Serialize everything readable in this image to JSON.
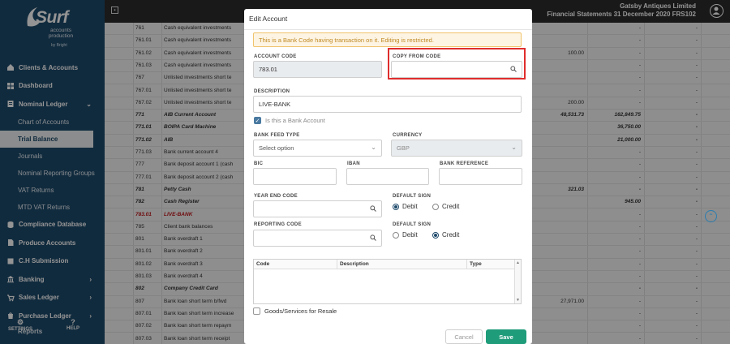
{
  "app": {
    "logo_text": "Surf",
    "logo_sub": "accounts production",
    "logo_by": "by Bright"
  },
  "sidebar": {
    "items": [
      {
        "label": "Clients & Accounts",
        "icon": "home-icon"
      },
      {
        "label": "Dashboard",
        "icon": "dashboard-icon"
      },
      {
        "label": "Nominal Ledger",
        "icon": "ledger-icon",
        "chevron": "⌄"
      }
    ],
    "sub_items": [
      {
        "label": "Chart of Accounts"
      },
      {
        "label": "Trial Balance",
        "active": true
      },
      {
        "label": "Journals"
      },
      {
        "label": "Nominal Reporting Groups"
      },
      {
        "label": "VAT Returns"
      },
      {
        "label": "MTD VAT Returns"
      }
    ],
    "items2": [
      {
        "label": "Compliance Database",
        "icon": "database-icon"
      },
      {
        "label": "Produce Accounts",
        "icon": "document-icon"
      },
      {
        "label": "C.H Submission",
        "icon": "upload-icon"
      },
      {
        "label": "Banking",
        "icon": "bank-icon",
        "chevron": "›"
      },
      {
        "label": "Sales Ledger",
        "icon": "sales-icon",
        "chevron": "›"
      },
      {
        "label": "Purchase Ledger",
        "icon": "purchase-icon",
        "chevron": "›"
      }
    ],
    "settings_label": "SETTINGS",
    "help_label": "HELP",
    "reports_label": "Reports"
  },
  "topbar": {
    "company": "Gatsby Antiques Limited",
    "statement": "Financial Statements 31 December 2020 FRS102"
  },
  "grid_rows": [
    {
      "code": "761",
      "name": "Cash equivalent investments",
      "v1": "",
      "v2": "-",
      "v3": "-"
    },
    {
      "code": "761.01",
      "name": "Cash equivalent investments",
      "v1": "",
      "v2": "-",
      "v3": "-"
    },
    {
      "code": "761.02",
      "name": "Cash equivalent investments",
      "v1": "100.00",
      "v2": "-",
      "v3": "-"
    },
    {
      "code": "761.03",
      "name": "Cash equivalent investments",
      "v1": "",
      "v2": "-",
      "v3": "-"
    },
    {
      "code": "767",
      "name": "Unlisted investments short te",
      "v1": "",
      "v2": "-",
      "v3": "-"
    },
    {
      "code": "767.01",
      "name": "Unlisted investments short te",
      "v1": "",
      "v2": "-",
      "v3": "-"
    },
    {
      "code": "767.02",
      "name": "Unlisted investments short te",
      "v1": "200.00",
      "v2": "-",
      "v3": "-"
    },
    {
      "code": "771",
      "name": "AIB Current Account",
      "v1": "48,531.73",
      "v2": "162,849.75",
      "v3": "-",
      "bold": true
    },
    {
      "code": "771.01",
      "name": "BOIPA Card Machine",
      "v1": "",
      "v2": "36,750.00",
      "v3": "-",
      "bold": true
    },
    {
      "code": "771.02",
      "name": "AIB",
      "v1": "",
      "v2": "21,000.00",
      "v3": "-",
      "bold": true
    },
    {
      "code": "771.03",
      "name": "Bank current account 4",
      "v1": "",
      "v2": "-",
      "v3": "-"
    },
    {
      "code": "777",
      "name": "Bank deposit account 1 (cash",
      "v1": "",
      "v2": "-",
      "v3": "-"
    },
    {
      "code": "777.01",
      "name": "Bank deposit account 2 (cash",
      "v1": "",
      "v2": "-",
      "v3": "-"
    },
    {
      "code": "781",
      "name": "Petty Cash",
      "v1": "321.03",
      "v2": "-",
      "v3": "-",
      "bold": true
    },
    {
      "code": "782",
      "name": "Cash Register",
      "v1": "",
      "v2": "945.00",
      "v3": "-",
      "bold": true
    },
    {
      "code": "783.01",
      "name": "LIVE-BANK",
      "v1": "",
      "v2": "-",
      "v3": "-",
      "red": true
    },
    {
      "code": "785",
      "name": "Client bank balances",
      "v1": "",
      "v2": "-",
      "v3": "-"
    },
    {
      "code": "801",
      "name": "Bank overdraft 1",
      "v1": "",
      "v2": "-",
      "v3": "-"
    },
    {
      "code": "801.01",
      "name": "Bank overdraft 2",
      "v1": "",
      "v2": "-",
      "v3": "-"
    },
    {
      "code": "801.02",
      "name": "Bank overdraft 3",
      "v1": "",
      "v2": "-",
      "v3": "-"
    },
    {
      "code": "801.03",
      "name": "Bank overdraft 4",
      "v1": "",
      "v2": "-",
      "v3": "-"
    },
    {
      "code": "802",
      "name": "Company Credit Card",
      "v1": "",
      "v2": "-",
      "v3": "-",
      "bold": true
    },
    {
      "code": "807",
      "name": "Bank loan short term b/fwd",
      "v1": "27,971.00",
      "v2": "-",
      "v3": "-"
    },
    {
      "code": "807.01",
      "name": "Bank loan short term increase",
      "v1": "",
      "v2": "-",
      "v3": "-"
    },
    {
      "code": "807.02",
      "name": "Bank loan short term repaym",
      "v1": "",
      "v2": "-",
      "v3": "-"
    },
    {
      "code": "807.03",
      "name": "Bank loan short term receipt",
      "v1": "",
      "v2": "-",
      "v3": "-"
    }
  ],
  "modal": {
    "title": "Edit Account",
    "warning": "This is a Bank Code having transaction on it. Editing is restricted.",
    "account_code_label": "ACCOUNT CODE",
    "account_code_value": "783.01",
    "copy_from_label": "COPY FROM CODE",
    "copy_from_value": "",
    "description_label": "DESCRIPTION",
    "description_value": "LIVE-BANK",
    "is_bank_label": "Is this a Bank Account",
    "is_bank_checked": true,
    "bank_feed_label": "BANK FEED TYPE",
    "bank_feed_value": "Select option",
    "currency_label": "CURRENCY",
    "currency_value": "GBP",
    "bic_label": "BIC",
    "iban_label": "IBAN",
    "bank_ref_label": "BANK REFERENCE",
    "year_end_label": "YEAR END CODE",
    "default_sign_label": "DEFAULT SIGN",
    "default_sign_1": {
      "debit": "Debit",
      "credit": "Credit",
      "selected": "Debit"
    },
    "reporting_code_label": "REPORTING CODE",
    "default_sign_2_label": "DEFAULT SIGN",
    "default_sign_2": {
      "debit": "Debit",
      "credit": "Credit",
      "selected": "Credit"
    },
    "table_headers": [
      "Code",
      "Description",
      "Type"
    ],
    "goods_label": "Goods/Services for Resale",
    "cancel_label": "Cancel",
    "save_label": "Save"
  },
  "colors": {
    "sidebar": "#1e4a6b",
    "topbar": "#2b2b2b",
    "save": "#1f9c7a",
    "highlight": "#e02d2d",
    "warning_bg": "#fdf4e3"
  }
}
